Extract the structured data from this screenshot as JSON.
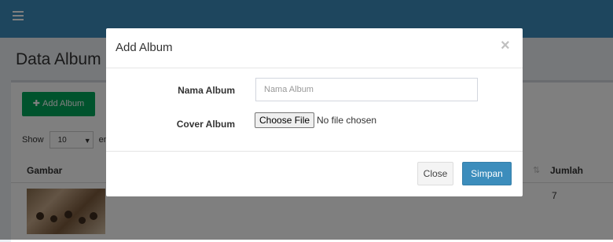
{
  "page": {
    "title": "Data Album",
    "add_button_label": "Add Album",
    "show_label": "Show",
    "show_value": "10",
    "entries_label": "ent",
    "table": {
      "headers": [
        "Gambar",
        "Jumlah"
      ],
      "rows": [
        {
          "jumlah": "7"
        }
      ]
    }
  },
  "modal": {
    "title": "Add Album",
    "close_symbol": "×",
    "fields": {
      "nama_album": {
        "label": "Nama Album",
        "placeholder": "Nama Album",
        "value": ""
      },
      "cover_album": {
        "label": "Cover Album",
        "button": "Choose File",
        "status": "No file chosen"
      }
    },
    "buttons": {
      "close": "Close",
      "save": "Simpan"
    }
  },
  "colors": {
    "header": "#3c8dbc",
    "success": "#00a65a",
    "primary": "#3c8dbc"
  }
}
